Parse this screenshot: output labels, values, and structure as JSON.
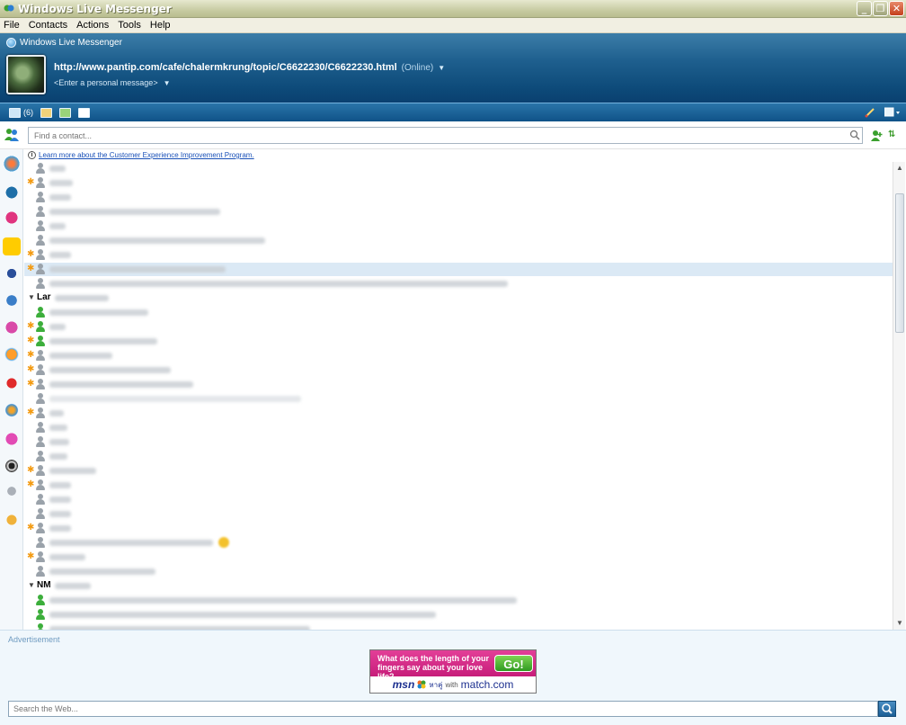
{
  "window": {
    "title": "Windows Live Messenger"
  },
  "menu": [
    "File",
    "Contacts",
    "Actions",
    "Tools",
    "Help"
  ],
  "header": {
    "brand": "Windows Live Messenger",
    "display_name": "http://www.pantip.com/cafe/chalermkrung/topic/C6622230/C6622230.html",
    "status": "(Online)",
    "personal_message": "<Enter a personal message>"
  },
  "toolbar": {
    "mail_count": "(6)"
  },
  "contact_search": {
    "placeholder": "Find a contact..."
  },
  "info_link": "Learn more about the Customer Experience Improvement Program.",
  "groups": [
    {
      "name": "Lar"
    },
    {
      "name": "NM"
    }
  ],
  "advertisement": {
    "label": "Advertisement",
    "question": "What does the length of your fingers say about your love life?",
    "go": "Go!",
    "brand_msn": "msn",
    "brand_thai": "หาคู่",
    "brand_with": "with",
    "brand_match": "match.com"
  },
  "web_search": {
    "placeholder": "Search the Web..."
  },
  "colors": {
    "header": "#1e5f8e",
    "accent_ad": "#d42a88",
    "selected_row": "#dbe9f5"
  }
}
